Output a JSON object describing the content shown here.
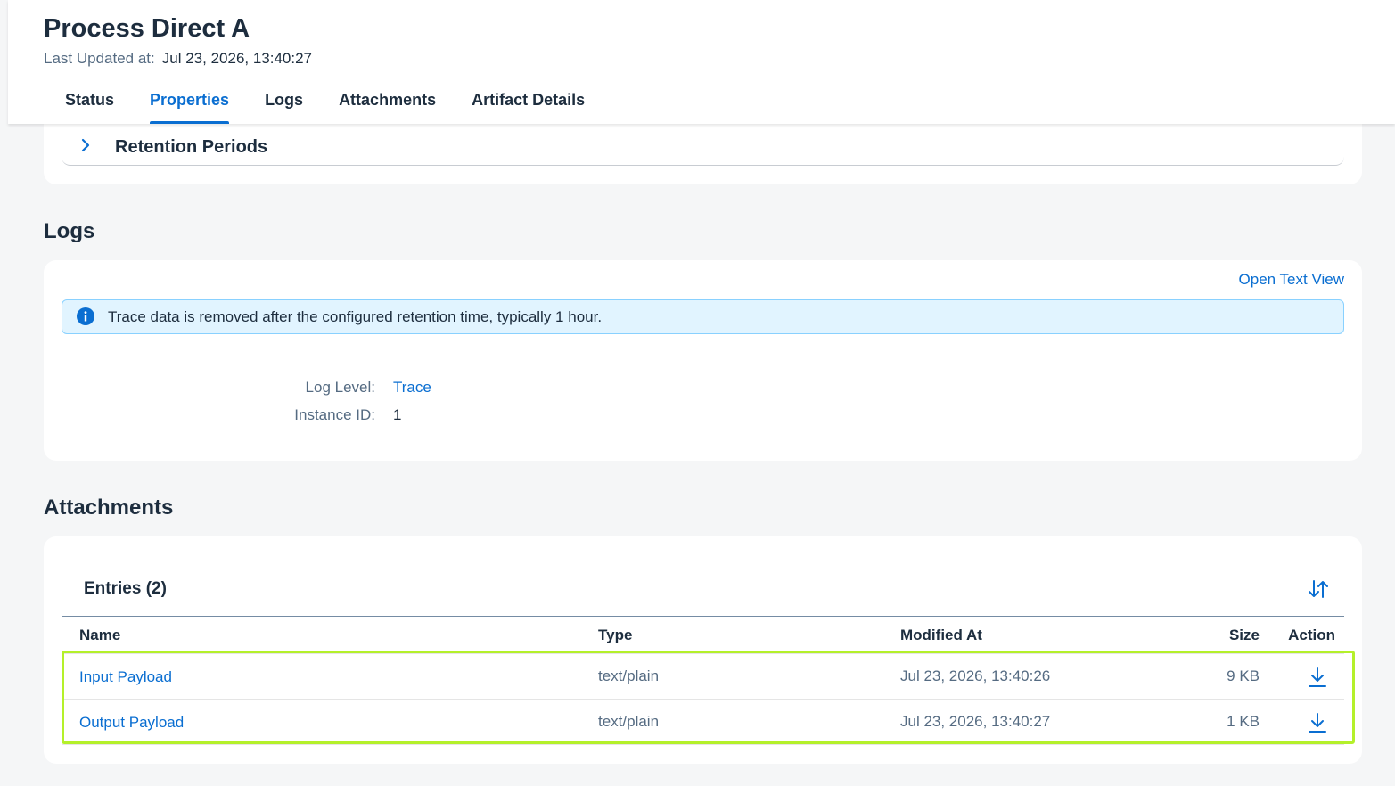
{
  "header": {
    "title": "Process Direct A",
    "last_updated_label": "Last Updated at:",
    "last_updated_value": "Jul 23, 2026, 13:40:27",
    "tabs": [
      {
        "label": "Status"
      },
      {
        "label": "Properties",
        "active": true
      },
      {
        "label": "Logs"
      },
      {
        "label": "Attachments"
      },
      {
        "label": "Artifact Details"
      }
    ]
  },
  "retention": {
    "label": "Retention Periods"
  },
  "logs": {
    "section_title": "Logs",
    "open_text_view": "Open Text View",
    "info_message": "Trace data is removed after the configured retention time, typically 1 hour.",
    "log_level_label": "Log Level:",
    "log_level_value": "Trace",
    "instance_id_label": "Instance ID:",
    "instance_id_value": "1"
  },
  "attachments": {
    "section_title": "Attachments",
    "entries_label": "Entries (2)",
    "columns": {
      "name": "Name",
      "type": "Type",
      "modified": "Modified At",
      "size": "Size",
      "action": "Action"
    },
    "rows": [
      {
        "name": "Input Payload",
        "type": "text/plain",
        "modified": "Jul 23, 2026, 13:40:26",
        "size": "9 KB"
      },
      {
        "name": "Output Payload",
        "type": "text/plain",
        "modified": "Jul 23, 2026, 13:40:27",
        "size": "1 KB"
      }
    ]
  },
  "colors": {
    "accent": "#0a6ed1",
    "highlight": "#b4f02a",
    "info_bg": "#e1f4ff"
  }
}
